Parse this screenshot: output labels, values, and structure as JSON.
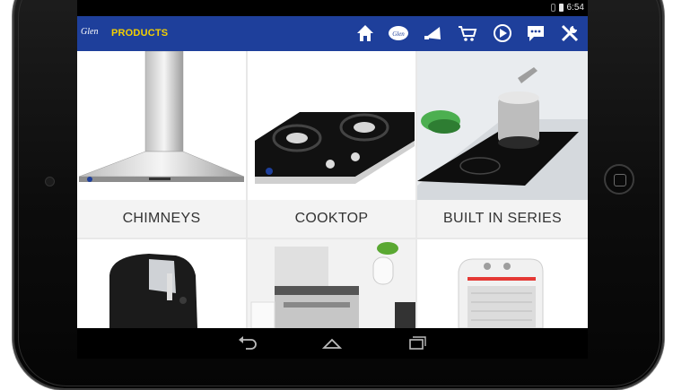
{
  "status_bar": {
    "time": "6:54"
  },
  "action_bar": {
    "logo": "Glen",
    "title": "PRODUCTS",
    "icons": [
      "home-icon",
      "glen-logo-icon",
      "announcement-icon",
      "cart-icon",
      "play-icon",
      "chat-icon",
      "tools-icon"
    ]
  },
  "tiles": [
    {
      "label": "CHIMNEYS"
    },
    {
      "label": "COOKTOP"
    },
    {
      "label": "BUILT IN SERIES"
    }
  ],
  "colors": {
    "action_bar": "#1e3f9b",
    "title": "#f4d000"
  },
  "nav_bar": {
    "icons": [
      "back-icon",
      "home-icon",
      "recents-icon"
    ]
  }
}
